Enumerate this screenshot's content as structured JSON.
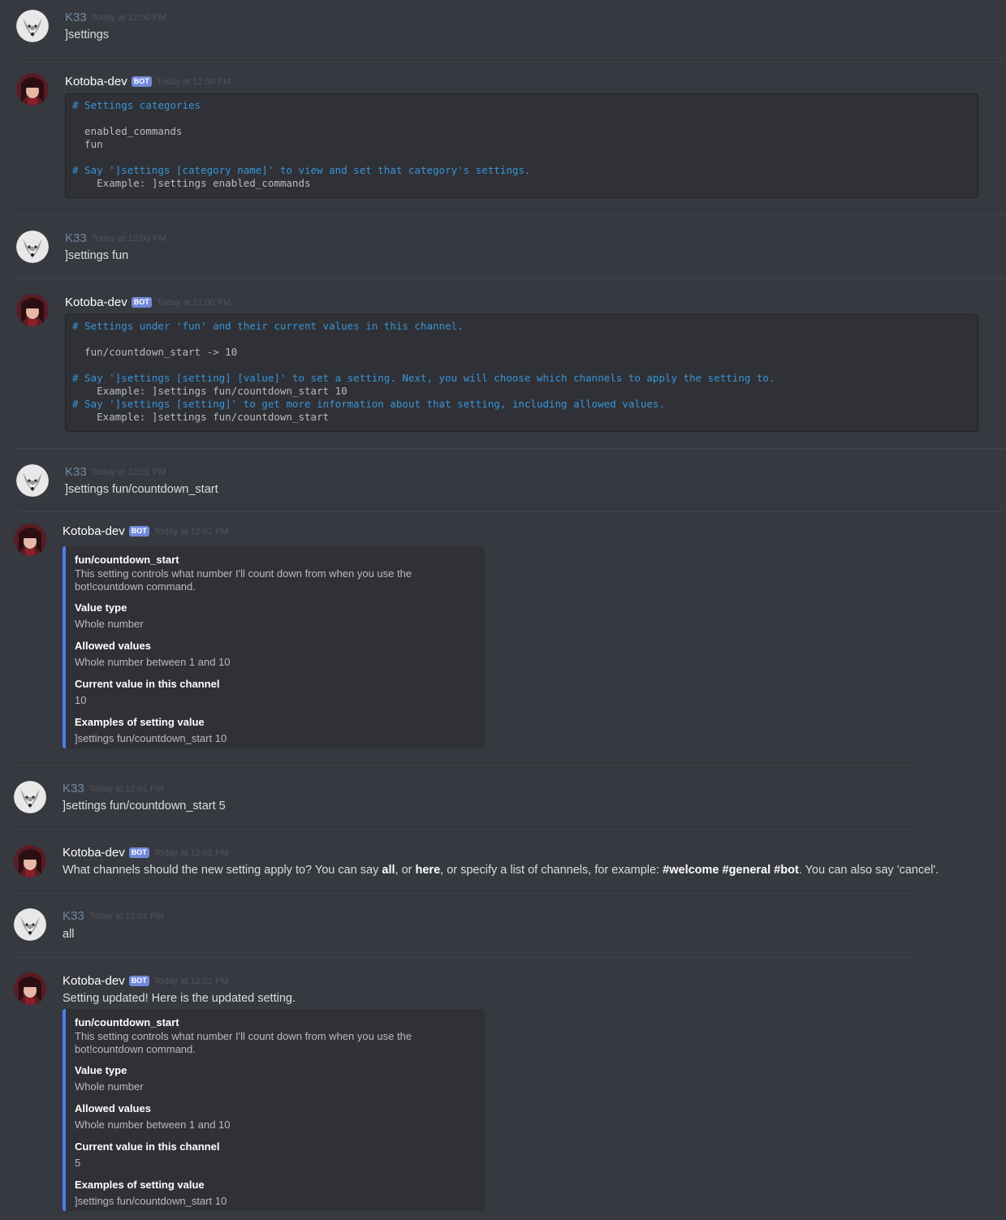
{
  "users": {
    "human": {
      "name": "K33"
    },
    "bot": {
      "name": "Kotoba-dev",
      "badge": "BOT"
    }
  },
  "messages": [
    {
      "author": "K33",
      "time": "Today at 12:00 PM",
      "text": "]settings"
    },
    {
      "author": "Kotoba-dev",
      "time": "Today at 12:00 PM",
      "code_lines": [
        {
          "t": "# Settings categories",
          "style": "hl"
        },
        {
          "t": "",
          "style": "pl"
        },
        {
          "t": "  enabled_commands",
          "style": "pl"
        },
        {
          "t": "  fun",
          "style": "pl"
        },
        {
          "t": "",
          "style": "pl"
        },
        {
          "t": "# Say ']settings [category name]' to view and set that category's settings.",
          "style": "hl"
        },
        {
          "t": "    Example: ]settings enabled_commands",
          "style": "pl"
        }
      ]
    },
    {
      "author": "K33",
      "time": "Today at 12:00 PM",
      "text": "]settings fun"
    },
    {
      "author": "Kotoba-dev",
      "time": "Today at 12:00 PM",
      "code_lines": [
        {
          "t": "# Settings under 'fun' and their current values in this channel.",
          "style": "hl"
        },
        {
          "t": "",
          "style": "pl"
        },
        {
          "t": "  fun/countdown_start -> 10",
          "style": "pl"
        },
        {
          "t": "",
          "style": "pl"
        },
        {
          "t": "# Say ']settings [setting] [value]' to set a setting. Next, you will choose which channels to apply the setting to.",
          "style": "hl"
        },
        {
          "t": "    Example: ]settings fun/countdown_start 10",
          "style": "pl"
        },
        {
          "t": "# Say ']settings [setting]' to get more information about that setting, including allowed values.",
          "style": "hl"
        },
        {
          "t": "    Example: ]settings fun/countdown_start",
          "style": "pl"
        }
      ]
    },
    {
      "author": "K33",
      "time": "Today at 12:01 PM",
      "text": "]settings fun/countdown_start"
    },
    {
      "author": "Kotoba-dev",
      "time": "Today at 12:01 PM",
      "embed": {
        "title": "fun/countdown_start",
        "description": "This setting controls what number I'll count down from when you use the\nbot!countdown command.",
        "fields": [
          {
            "name": "Value type",
            "value": "Whole number"
          },
          {
            "name": "Allowed values",
            "value": "Whole number between 1 and 10"
          },
          {
            "name": "Current value in this channel",
            "value": "10"
          },
          {
            "name": "Examples of setting value",
            "value": "]settings fun/countdown_start 10"
          }
        ]
      }
    },
    {
      "author": "K33",
      "time": "Today at 12:01 PM",
      "text": "]settings fun/countdown_start 5"
    },
    {
      "author": "Kotoba-dev",
      "time": "Today at 12:01 PM",
      "rich_text": [
        {
          "t": "What channels should the new setting apply to? You can say ",
          "b": false
        },
        {
          "t": "all",
          "b": true
        },
        {
          "t": ", or ",
          "b": false
        },
        {
          "t": "here",
          "b": true
        },
        {
          "t": ", or specify a list of channels, for example: ",
          "b": false
        },
        {
          "t": "#welcome #general #bot",
          "b": true
        },
        {
          "t": ". You can also say 'cancel'.",
          "b": false
        }
      ]
    },
    {
      "author": "K33",
      "time": "Today at 12:01 PM",
      "text": "all"
    },
    {
      "author": "Kotoba-dev",
      "time": "Today at 12:01 PM",
      "text": "Setting updated! Here is the updated setting.",
      "embed": {
        "title": "fun/countdown_start",
        "description": "This setting controls what number I'll count down from when you use the\nbot!countdown command.",
        "fields": [
          {
            "name": "Value type",
            "value": "Whole number"
          },
          {
            "name": "Allowed values",
            "value": "Whole number between 1 and 10"
          },
          {
            "name": "Current value in this channel",
            "value": "5"
          },
          {
            "name": "Examples of setting value",
            "value": "]settings fun/countdown_start 10"
          }
        ]
      }
    }
  ],
  "icons": {
    "user_avatar": "wolf-avatar-icon",
    "bot_avatar": "anime-girl-avatar-icon"
  },
  "colors": {
    "background": "#36393f",
    "embed_bar": "#4d7dea",
    "code_highlight": "#3a94d6",
    "bot_badge": "#7289da",
    "user_name": "#7289a5"
  }
}
